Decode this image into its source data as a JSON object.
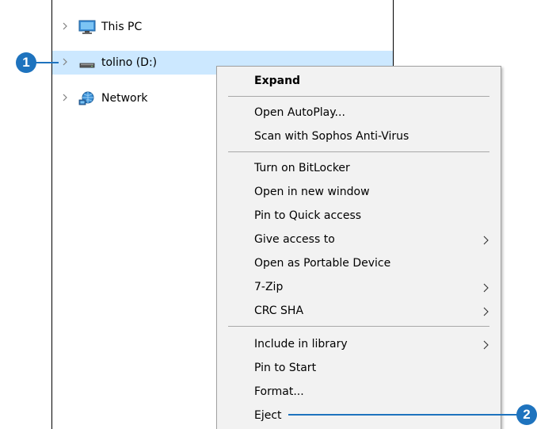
{
  "nav_pane": {
    "items": [
      {
        "label": "This PC",
        "icon": "this-pc-icon",
        "expand_icon": "chevron-right-icon"
      },
      {
        "label": "tolino (D:)",
        "icon": "drive-icon",
        "expand_icon": "chevron-right-icon",
        "selected": true
      },
      {
        "label": "Network",
        "icon": "network-icon",
        "expand_icon": "chevron-right-icon"
      }
    ]
  },
  "context_menu": {
    "items": [
      {
        "label": "Expand",
        "bold": true
      },
      {
        "separator": true
      },
      {
        "label": "Open AutoPlay..."
      },
      {
        "label": "Scan with Sophos Anti-Virus"
      },
      {
        "separator": true
      },
      {
        "label": "Turn on BitLocker"
      },
      {
        "label": "Open in new window"
      },
      {
        "label": "Pin to Quick access"
      },
      {
        "label": "Give access to",
        "submenu": true
      },
      {
        "label": "Open as Portable Device"
      },
      {
        "label": "7-Zip",
        "submenu": true
      },
      {
        "label": "CRC SHA",
        "submenu": true
      },
      {
        "separator": true
      },
      {
        "label": "Include in library",
        "submenu": true
      },
      {
        "label": "Pin to Start"
      },
      {
        "label": "Format..."
      },
      {
        "label": "Eject"
      }
    ]
  },
  "callouts": [
    {
      "number": "1",
      "target": "tolino (D:)"
    },
    {
      "number": "2",
      "target": "Eject"
    }
  ],
  "colors": {
    "selection": "#cce8ff",
    "menu_background": "#f2f2f2",
    "callout": "#1e73be"
  }
}
